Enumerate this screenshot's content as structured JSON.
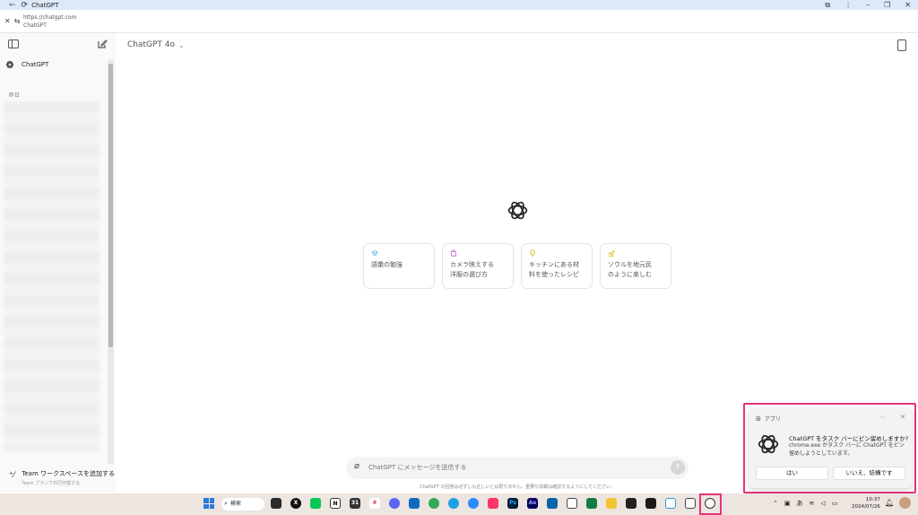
{
  "window": {
    "tab_title": "ChatGPT",
    "url": "https://chatgpt.com",
    "site_name": "ChatGPT"
  },
  "sidebar": {
    "chatgpt_label": "ChatGPT",
    "section_label": "昨日",
    "team_title": "Team ワークスペースを追加する",
    "team_subtitle": "Team プランで共同作業する"
  },
  "header": {
    "model_name": "ChatGPT 4o",
    "model_chevron": "⌄"
  },
  "suggestions": [
    {
      "line1": "語彙の勉強",
      "line2": "",
      "icon": "graduation-cap-icon",
      "color": "#55b6e8"
    },
    {
      "line1": "カメラ映えする",
      "line2": "洋服の選び方",
      "icon": "shopping-bag-icon",
      "color": "#c25ed8"
    },
    {
      "line1": "キッチンにある材",
      "line2": "料を使ったレシピ",
      "icon": "lightbulb-icon",
      "color": "#e4b820"
    },
    {
      "line1": "ソウルを地元民",
      "line2": "のように楽しむ",
      "icon": "airplane-icon",
      "color": "#e4b820"
    }
  ],
  "composer": {
    "placeholder": "ChatGPT にメッセージを送信する",
    "disclaimer": "ChatGPT の回答は必ずしも正しいとは限りません。重要な情報は確認するようにしてください。"
  },
  "notification": {
    "source": "アプリ",
    "title": "ChatGPT をタスク バーにピン留めしますか?",
    "body": "chrome.exe がタスク バーに ChatGPT をピン留めしようとしています。",
    "yes_label": "はい",
    "no_label": "いいえ、結構です",
    "accent_color": "#e6337a"
  },
  "taskbar": {
    "search_label": "検索",
    "ime_label": "あ",
    "time": "10:37",
    "date": "2024/07/26"
  }
}
